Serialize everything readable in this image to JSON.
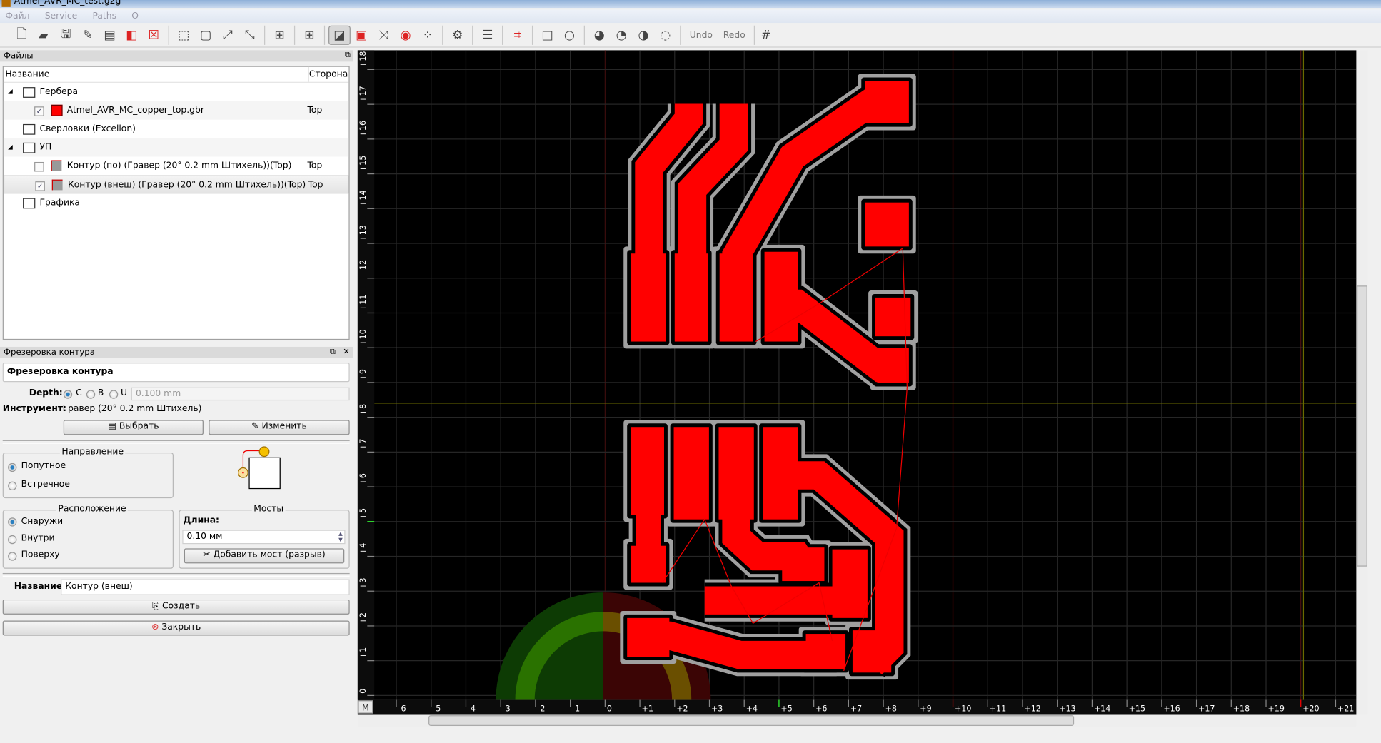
{
  "window": {
    "title": "Atmel_AVR_MC_test.g2g"
  },
  "menu": [
    "Файл",
    "Service",
    "Paths",
    "O"
  ],
  "toolbar": {
    "groups": [
      [
        "new-file-icon",
        "open-file-icon",
        "save-icon",
        "save-as-icon",
        "save-all-icon",
        "close-red-icon",
        "close-all-icon"
      ],
      [
        "zoom-fit-icon",
        "zoom-page-icon",
        "zoom-in-icon",
        "zoom-out-icon"
      ],
      [
        "zoom-selection-icon"
      ],
      [
        "select-all-icon"
      ],
      [
        "profile-tool-icon",
        "pocket-tool-icon",
        "thermal-tool-icon",
        "drill-tool-icon",
        "voronoi-tool-icon"
      ],
      [
        "autoplace-icon"
      ],
      [
        "gcode-properties-icon"
      ],
      [
        "pcb-bounds-icon"
      ],
      [
        "rectangle-icon",
        "circle-icon"
      ],
      [
        "union-icon",
        "difference-icon",
        "exclusion-icon",
        "intersection-icon"
      ]
    ],
    "active": "profile-tool-icon",
    "undo": "Undo",
    "redo": "Redo",
    "extra": "snap-grid-icon"
  },
  "files_panel": {
    "title": "Файлы",
    "col_name": "Название",
    "col_side": "Сторона",
    "rows": [
      {
        "label": "Гербера",
        "side": "",
        "level": 0,
        "type": "folder",
        "expanded": true
      },
      {
        "label": "Atmel_AVR_MC_copper_top.gbr",
        "side": "Top",
        "level": 1,
        "type": "gerber",
        "checked": true,
        "color": "#ff0000"
      },
      {
        "label": "Сверловки (Excellon)",
        "side": "",
        "level": 0,
        "type": "folder"
      },
      {
        "label": "УП",
        "side": "",
        "level": 0,
        "type": "folder",
        "expanded": true
      },
      {
        "label": "Контур (по) (Гравер (20° 0.2 mm Штихель))(Top)",
        "side": "Top",
        "level": 1,
        "type": "toolpath",
        "checked": false
      },
      {
        "label": "Контур (внеш) (Гравер (20° 0.2 mm Штихель))(Top)",
        "side": "Top",
        "level": 1,
        "type": "toolpath",
        "checked": true,
        "selected": true
      },
      {
        "label": "Графика",
        "side": "",
        "level": 0,
        "type": "folder"
      }
    ]
  },
  "profile_panel": {
    "dock_title": "Фрезеровка контура",
    "title": "Фрезеровка контура",
    "depth_label": "Depth:",
    "depth_options": [
      "C",
      "B",
      "U"
    ],
    "depth_selected": "C",
    "depth_value": "0.100 mm",
    "tool_label": "Инструмент:",
    "tool_value": "Гравер (20° 0.2 mm Штихель)",
    "select_btn": "Выбрать",
    "edit_btn": "Изменить",
    "direction": {
      "title": "Направление",
      "options": [
        "Попутное",
        "Встречное"
      ],
      "selected": "Попутное"
    },
    "side": {
      "title": "Расположение",
      "options": [
        "Снаружи",
        "Внутри",
        "Поверху"
      ],
      "selected": "Снаружи"
    },
    "bridges": {
      "title": "Мосты",
      "length_label": "Длина:",
      "length_value": "0.10 мм",
      "add_btn": "Добавить мост (разрыв)"
    },
    "name_label": "Название:",
    "name_value": "Контур (внеш)",
    "create_btn": "Создать",
    "close_btn": "Закрыть"
  },
  "canvas": {
    "background": "#000000",
    "copper_color": "#ff0000",
    "toolpath_color": "#a0a0a0",
    "x_ticks": [
      "-6",
      "-5",
      "-4",
      "-3",
      "-2",
      "-1",
      "0",
      "+1",
      "+2",
      "+3",
      "+4",
      "+5",
      "+6",
      "+7",
      "+8",
      "+9",
      "+10",
      "+11",
      "+12",
      "+13",
      "+14",
      "+15",
      "+16",
      "+17",
      "+18",
      "+19",
      "+20",
      "+21"
    ],
    "y_ticks": [
      "0",
      "+1",
      "+2",
      "+3",
      "+4",
      "+5",
      "+6",
      "+7",
      "+8",
      "+9",
      "+10",
      "+11",
      "+12",
      "+13",
      "+14",
      "+15",
      "+16",
      "+17",
      "+18"
    ],
    "ruler_corner": "M"
  }
}
